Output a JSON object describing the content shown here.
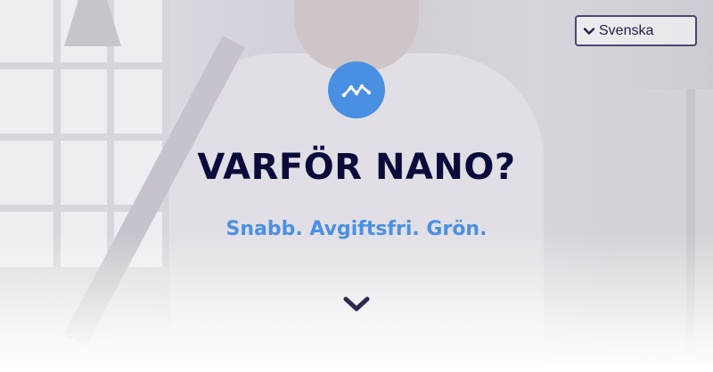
{
  "language_select": {
    "selected": "Svenska",
    "icon": "chevron-down-icon"
  },
  "logo": {
    "icon": "nano-logo-icon",
    "color": "#4a90e2"
  },
  "hero": {
    "title": "VARFÖR NANO?",
    "subtitle": "Snabb. Avgiftsfri. Grön.",
    "scroll_icon": "chevron-down-icon"
  },
  "colors": {
    "title": "#0b0b3b",
    "accent": "#4a90e2",
    "border": "#4a4770"
  }
}
